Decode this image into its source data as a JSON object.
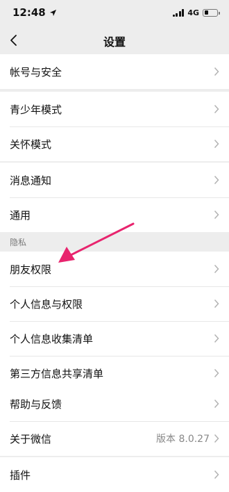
{
  "status_bar": {
    "time": "12:48",
    "network": "4G",
    "battery_level": 0.35
  },
  "nav": {
    "title": "设置"
  },
  "groups": [
    {
      "rows": [
        {
          "label": "帐号与安全"
        }
      ]
    },
    {
      "rows": [
        {
          "label": "青少年模式"
        },
        {
          "label": "关怀模式"
        }
      ]
    },
    {
      "rows": [
        {
          "label": "消息通知"
        },
        {
          "label": "通用"
        }
      ]
    },
    {
      "header": "隐私",
      "rows": [
        {
          "label": "朋友权限"
        },
        {
          "label": "个人信息与权限"
        },
        {
          "label": "个人信息收集清单"
        },
        {
          "label": "第三方信息共享清单"
        }
      ]
    },
    {
      "rows": [
        {
          "label": "帮助与反馈"
        },
        {
          "label": "关于微信",
          "value": "版本 8.0.27"
        }
      ]
    },
    {
      "rows": [
        {
          "label": "插件"
        }
      ]
    }
  ],
  "annotation": {
    "color": "#e8246e"
  }
}
